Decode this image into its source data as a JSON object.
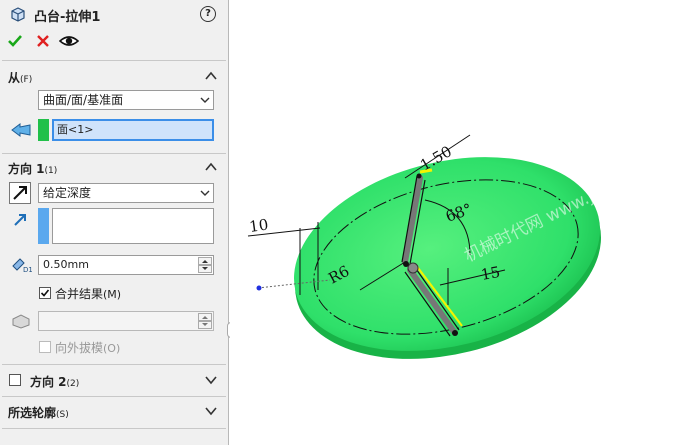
{
  "header": {
    "title": "凸台-拉伸1",
    "help": "?"
  },
  "sections": {
    "from": {
      "label": "从",
      "hotkey": "(F)",
      "type_value": "曲面/面/基准面",
      "selection_value": "面<1>"
    },
    "direction1": {
      "label": "方向 1",
      "hotkey": "(1)",
      "end_condition": "给定深度",
      "depth": "0.50mm",
      "merge_label": "合并结果",
      "merge_hotkey": "(M)",
      "merge_checked": true,
      "draft_outward_label": "向外拔模",
      "draft_outward_hotkey": "(O)"
    },
    "direction2": {
      "label": "方向 2",
      "hotkey": "(2)"
    },
    "contours": {
      "label": "所选轮廓",
      "hotkey": "(S)"
    }
  },
  "viewport": {
    "dims": {
      "d1": "1.50",
      "d2": "68°",
      "d3": "10",
      "d4": "R6",
      "d5": "15"
    },
    "watermark": "机械时代网 www.jixage.com",
    "colors": {
      "body": "#2fe06a",
      "body_dark": "#16b948",
      "highlight": "#f4f400"
    }
  },
  "colors": {
    "accent_blue": "#3b8ee8",
    "green_swatch": "#21c04a",
    "ok_green": "#1aa81a",
    "cancel_red": "#e02020"
  }
}
